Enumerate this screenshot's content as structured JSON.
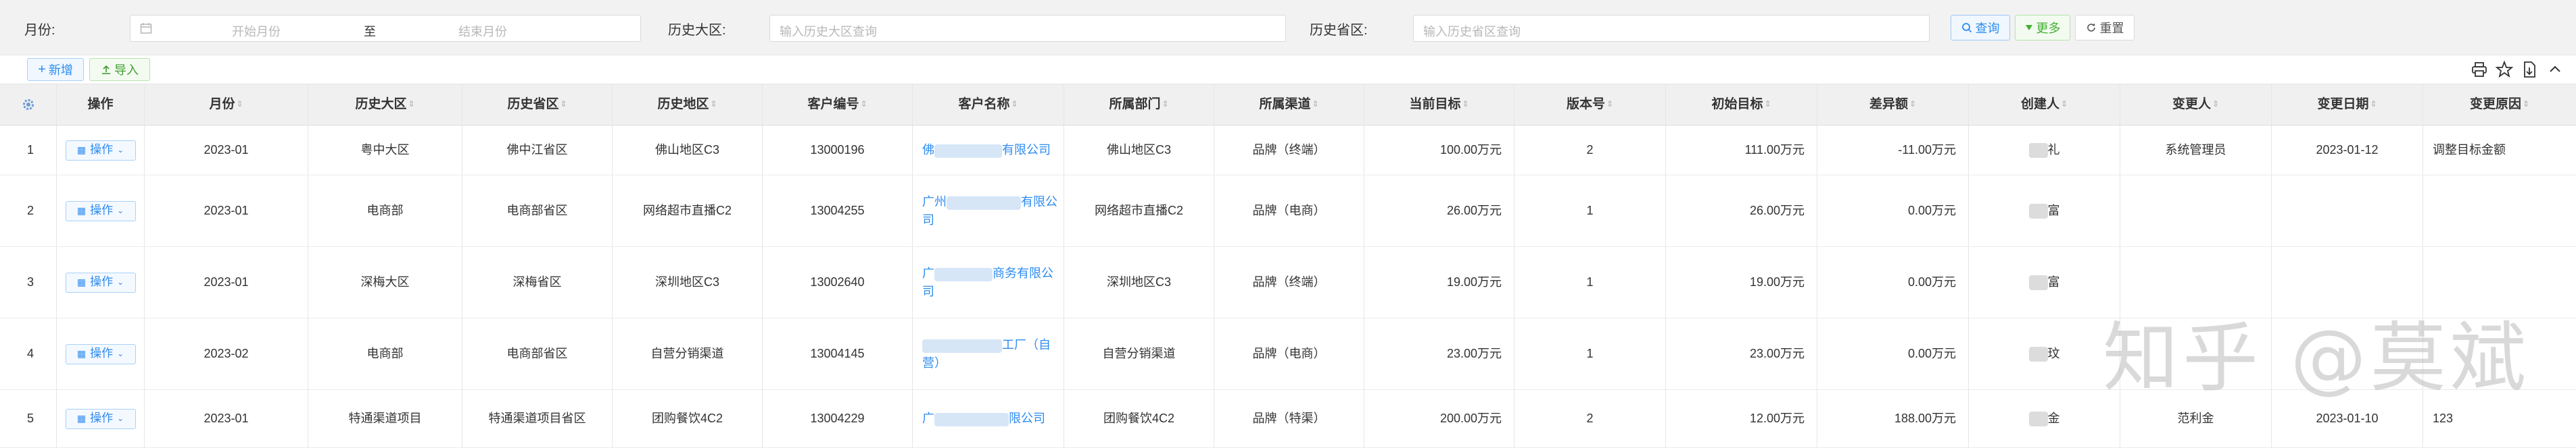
{
  "filters": {
    "month_label": "月份:",
    "month_start_placeholder": "开始月份",
    "month_to": "至",
    "month_end_placeholder": "结束月份",
    "region_label": "历史大区:",
    "region_placeholder": "输入历史大区查询",
    "province_label": "历史省区:",
    "province_placeholder": "输入历史省区查询",
    "query": "查询",
    "more": "更多",
    "reset": "重置"
  },
  "toolbar": {
    "new_label": "新增",
    "import_label": "导入"
  },
  "columns": [
    "操作",
    "月份",
    "历史大区",
    "历史省区",
    "历史地区",
    "客户编号",
    "客户名称",
    "所属部门",
    "所属渠道",
    "当前目标",
    "版本号",
    "初始目标",
    "差异额",
    "创建人",
    "变更人",
    "变更日期",
    "变更原因"
  ],
  "op_label": "操作",
  "rows": [
    {
      "idx": "1",
      "month": "2023-01",
      "region": "粤中大区",
      "province": "佛中江省区",
      "area": "佛山地区C3",
      "code": "13000196",
      "name_a": "佛",
      "name_b": "有限公司",
      "dept": "佛山地区C3",
      "channel": "品牌（终端）",
      "cur": "100.00万元",
      "ver": "2",
      "init": "111.00万元",
      "diff": "-11.00万元",
      "creator": "礼",
      "changer": "系统管理员",
      "cdate": "2023-01-12",
      "reason": "调整目标金额"
    },
    {
      "idx": "2",
      "month": "2023-01",
      "region": "电商部",
      "province": "电商部省区",
      "area": "网络超市直播C2",
      "code": "13004255",
      "name_a": "广州",
      "name_b": "有限公司",
      "dept": "网络超市直播C2",
      "channel": "品牌（电商）",
      "cur": "26.00万元",
      "ver": "1",
      "init": "26.00万元",
      "diff": "0.00万元",
      "creator": "富",
      "changer": "",
      "cdate": "",
      "reason": ""
    },
    {
      "idx": "3",
      "month": "2023-01",
      "region": "深梅大区",
      "province": "深梅省区",
      "area": "深圳地区C3",
      "code": "13002640",
      "name_a": "广",
      "name_b": "商务有限公",
      "name_c": "司",
      "dept": "深圳地区C3",
      "channel": "品牌（终端）",
      "cur": "19.00万元",
      "ver": "1",
      "init": "19.00万元",
      "diff": "0.00万元",
      "creator": "富",
      "changer": "",
      "cdate": "",
      "reason": ""
    },
    {
      "idx": "4",
      "month": "2023-02",
      "region": "电商部",
      "province": "电商部省区",
      "area": "自营分销渠道",
      "code": "13004145",
      "name_a": "",
      "name_b": "工厂（自",
      "name_c": "营）",
      "dept": "自营分销渠道",
      "channel": "品牌（电商）",
      "cur": "23.00万元",
      "ver": "1",
      "init": "23.00万元",
      "diff": "0.00万元",
      "creator": "玟",
      "changer": "",
      "cdate": "",
      "reason": ""
    },
    {
      "idx": "5",
      "month": "2023-01",
      "region": "特通渠道项目",
      "province": "特通渠道项目省区",
      "area": "团购餐饮4C2",
      "code": "13004229",
      "name_a": "广",
      "name_b": "限公司",
      "dept": "团购餐饮4C2",
      "channel": "品牌（特渠）",
      "cur": "200.00万元",
      "ver": "2",
      "init": "12.00万元",
      "diff": "188.00万元",
      "creator": "金",
      "changer": "范利金",
      "cdate": "2023-01-10",
      "reason": "123"
    }
  ],
  "watermark": "知乎 @莫斌"
}
